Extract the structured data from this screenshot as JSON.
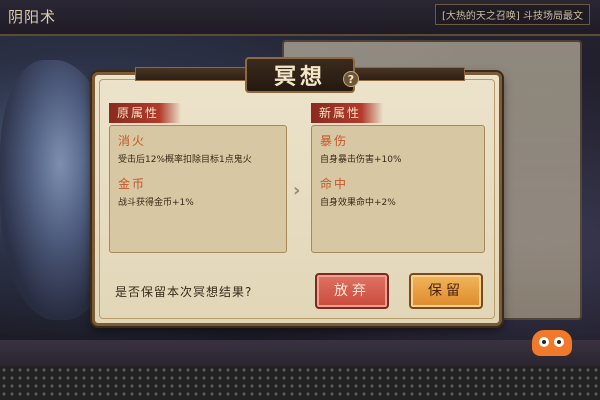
{
  "header": {
    "app_title": "阴阳术",
    "banner": "[大热的天之召唤] 斗技场局最文"
  },
  "dialog": {
    "title": "冥想",
    "help_icon": "question-icon",
    "original": {
      "label": "原属性",
      "attributes": [
        {
          "name": "消火",
          "description": "受击后12%概率扣除目标1点鬼火"
        },
        {
          "name": "金币",
          "description": "战斗获得金币+1%"
        }
      ]
    },
    "new": {
      "label": "新属性",
      "attributes": [
        {
          "name": "暴伤",
          "description": "自身暴击伤害+10%"
        },
        {
          "name": "命中",
          "description": "自身效果命中+2%"
        }
      ]
    },
    "arrow_icon": "chevron-right-icon",
    "question": "是否保留本次冥想结果?",
    "abandon_label": "放弃",
    "keep_label": "保留"
  },
  "colors": {
    "abandon_button": "#c84a3c",
    "keep_button": "#dd8a2c",
    "attribute_name": "#c4582a",
    "label_strip": "#b23a2b"
  }
}
